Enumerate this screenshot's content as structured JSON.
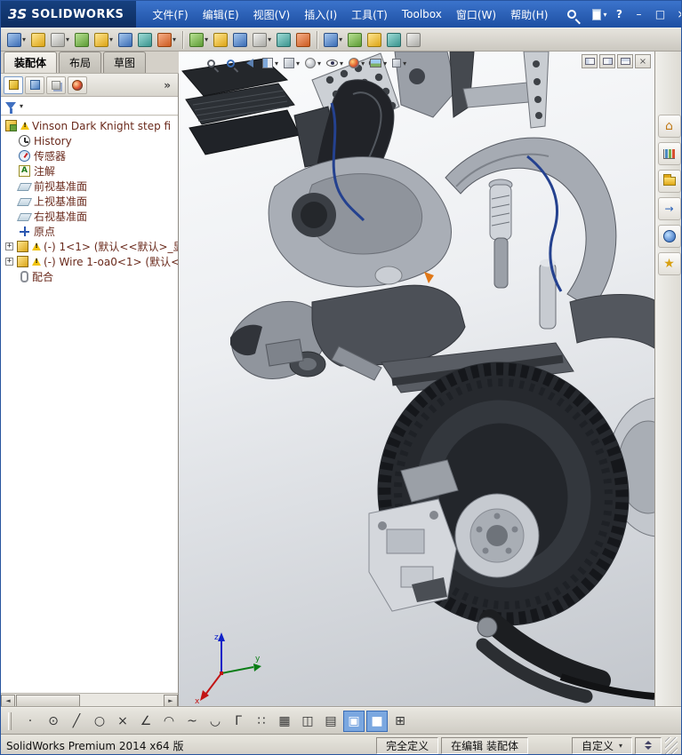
{
  "glyphs": {
    "dropdown": "▾",
    "help": "?",
    "minimize": "–",
    "restore": "□",
    "close": "×",
    "panel_expand": "»",
    "scroll_left": "◄",
    "scroll_right": "►",
    "plus": "+",
    "home": "⌂",
    "star": "★",
    "arrow": "→",
    "annotation": "A"
  },
  "titlebar": {
    "brand_mark": "3S",
    "brand": "SOLIDWORKS",
    "menus": [
      "文件(F)",
      "编辑(E)",
      "视图(V)",
      "插入(I)",
      "工具(T)",
      "Toolbox",
      "窗口(W)",
      "帮助(H)"
    ]
  },
  "toolbar": {
    "icons": [
      "insert-components",
      "mate",
      "linear-component-pattern",
      "smart-fasteners",
      "move-component",
      "rotate-component",
      "show-hidden-components",
      "assembly-features",
      "reference-geometry",
      "new-motion-study",
      "bill-of-materials",
      "exploded-view",
      "explode-line-sketch",
      "interference-detection",
      "clearance-verification",
      "hole-alignment",
      "measure",
      "mass-properties",
      "section-properties"
    ]
  },
  "tabs": [
    {
      "label": "装配体",
      "active": true
    },
    {
      "label": "布局",
      "active": false
    },
    {
      "label": "草图",
      "active": false
    }
  ],
  "fm": {
    "tree": [
      {
        "icon": "assembly",
        "warning": true,
        "label": "Vinson Dark Knight step fi"
      },
      {
        "icon": "history",
        "label": "History"
      },
      {
        "icon": "sensors",
        "label": "传感器"
      },
      {
        "icon": "annotations",
        "label": "注解"
      },
      {
        "icon": "plane",
        "label": "前视基准面"
      },
      {
        "icon": "plane",
        "label": "上视基准面"
      },
      {
        "icon": "plane",
        "label": "右视基准面"
      },
      {
        "icon": "origin",
        "label": "原点"
      },
      {
        "icon": "part",
        "warning": true,
        "expander": "+",
        "label": "(-) 1<1> (默认<<默认>_显"
      },
      {
        "icon": "part",
        "warning": true,
        "expander": "+",
        "label": "(-) Wire 1-oa0<1> (默认<"
      },
      {
        "icon": "mates",
        "label": "配合"
      }
    ]
  },
  "headsup": {
    "icons": [
      "zoom-to-fit",
      "zoom-to-area",
      "previous-view",
      "section-view",
      "view-orientation",
      "display-style",
      "hide-show-items",
      "edit-appearance",
      "apply-scene",
      "view-settings"
    ],
    "corner_icons": [
      "window-pane-left",
      "window-pane-right",
      "window-pane-both",
      "viewport-close"
    ]
  },
  "taskpane": {
    "icons": [
      "solidworks-resources",
      "design-library",
      "file-explorer",
      "view-palette",
      "appearances-scenes",
      "custom-properties"
    ]
  },
  "sketchbar": {
    "icons": [
      {
        "name": "point-tool",
        "glyph": "·"
      },
      {
        "name": "perimeter-circle-tool",
        "glyph": "⊙"
      },
      {
        "name": "line-tool",
        "glyph": "╱"
      },
      {
        "name": "circle-tool",
        "glyph": "○"
      },
      {
        "name": "trim-entities-tool",
        "glyph": "×"
      },
      {
        "name": "smart-dimension-tool",
        "glyph": "∠"
      },
      {
        "name": "arc-tool",
        "glyph": "◠"
      },
      {
        "name": "spline-tool",
        "glyph": "~"
      },
      {
        "name": "tangent-arc-tool",
        "glyph": "◡"
      },
      {
        "name": "corner-rectangle-tool",
        "glyph": "Γ"
      },
      {
        "name": "linear-sketch-pattern-tool",
        "glyph": "∷"
      },
      {
        "name": "grid-system-tool",
        "glyph": "▦"
      },
      {
        "name": "mirror-entities-tool",
        "glyph": "◫"
      },
      {
        "name": "convert-entities-tool",
        "glyph": "▤"
      },
      {
        "name": "shaded-sketch-contours-tool",
        "glyph": "▣",
        "active": true
      },
      {
        "name": "instant2d-tool",
        "glyph": "■",
        "active": true
      },
      {
        "name": "tables-tool",
        "glyph": "⊞"
      }
    ]
  },
  "triad": {
    "x": "x",
    "y": "y",
    "z": "z"
  },
  "statusbar": {
    "product": "SolidWorks Premium 2014 x64 版",
    "state": "完全定义",
    "editing": "在编辑 装配体",
    "custom": "自定义"
  }
}
